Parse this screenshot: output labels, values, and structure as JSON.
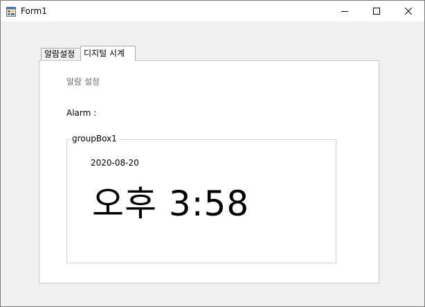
{
  "window": {
    "title": "Form1",
    "app_icon": "winforms-app-icon",
    "controls": {
      "minimize_icon": "minimize-icon",
      "maximize_icon": "maximize-icon",
      "close_icon": "close-icon"
    }
  },
  "tabs": [
    {
      "label": "알람설정",
      "selected": false
    },
    {
      "label": "디지털 시계",
      "selected": true
    }
  ],
  "panel": {
    "alarm_setting_label": "알람 설정",
    "alarm_label": "Alarm :",
    "groupbox": {
      "title": "groupBox1",
      "date": "2020-08-20",
      "time": "오후 3:58"
    }
  },
  "colors": {
    "window_bg": "#f0f0f0",
    "panel_bg": "#ffffff",
    "muted_text": "#6d6d6d"
  }
}
